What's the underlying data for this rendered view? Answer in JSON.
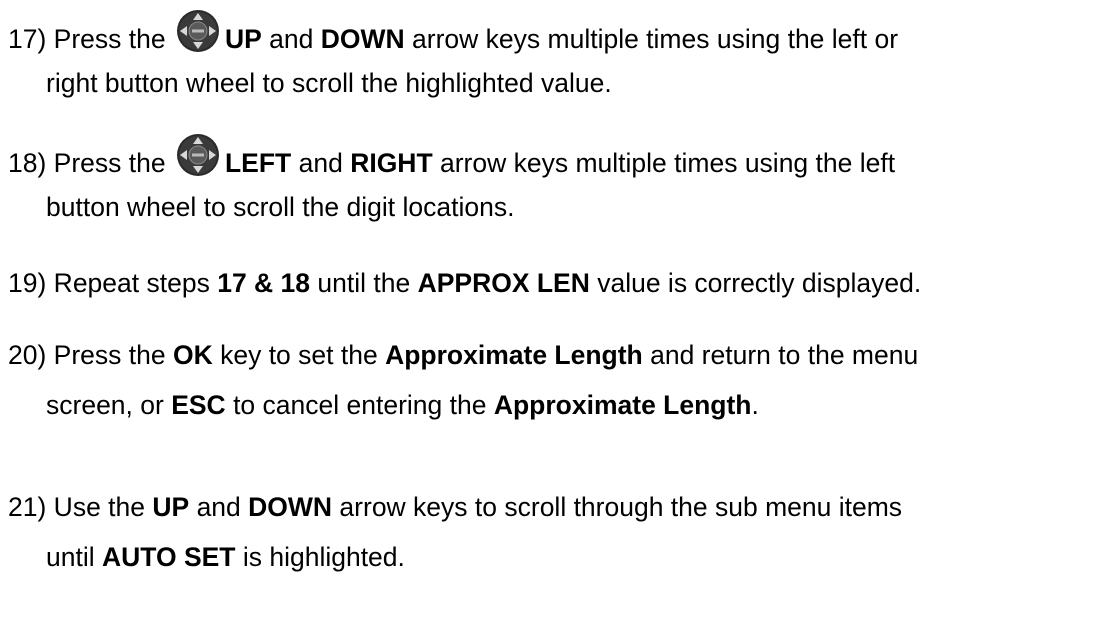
{
  "steps": [
    {
      "number": "17)",
      "text_1": " Press the ",
      "icon": "dpad-enter-icon",
      "key_1": "UP",
      "text_2": " and ",
      "key_2": "DOWN",
      "text_3": " arrow keys multiple times using the left or",
      "line_2": "right button wheel to scroll the highlighted value."
    },
    {
      "number": "18)",
      "text_1": " Press the ",
      "icon": "dpad-enter-icon",
      "key_1": "LEFT",
      "text_2": " and ",
      "key_2": "RIGHT",
      "text_3": " arrow keys multiple times using the left",
      "line_2": "button wheel to scroll the digit locations."
    },
    {
      "number": "19)",
      "text_1": " Repeat steps ",
      "ref": "17 & 18",
      "text_2": " until the ",
      "field": "APPROX LEN",
      "text_3": " value is correctly displayed."
    },
    {
      "number": "20)",
      "text_1": " Press the ",
      "key_ok": "OK",
      "text_2": " key to set the ",
      "term_1": "Approximate Length",
      "text_3": " and return to the menu",
      "line_2a": "screen, or ",
      "key_esc": "ESC",
      "line_2b": " to cancel entering the ",
      "term_2": "Approximate Length",
      "line_2c": "."
    },
    {
      "number": "21)",
      "text_1": " Use the ",
      "key_1": "UP",
      "text_2": " and ",
      "key_2": "DOWN",
      "text_3": " arrow keys to scroll through the sub menu items",
      "line_2a": "until ",
      "item": "AUTO SET",
      "line_2b": " is highlighted."
    }
  ],
  "icon_colors": {
    "outer": "#2a2a2a",
    "arrow": "#d8d8d8",
    "center": "#5a5a5a"
  }
}
